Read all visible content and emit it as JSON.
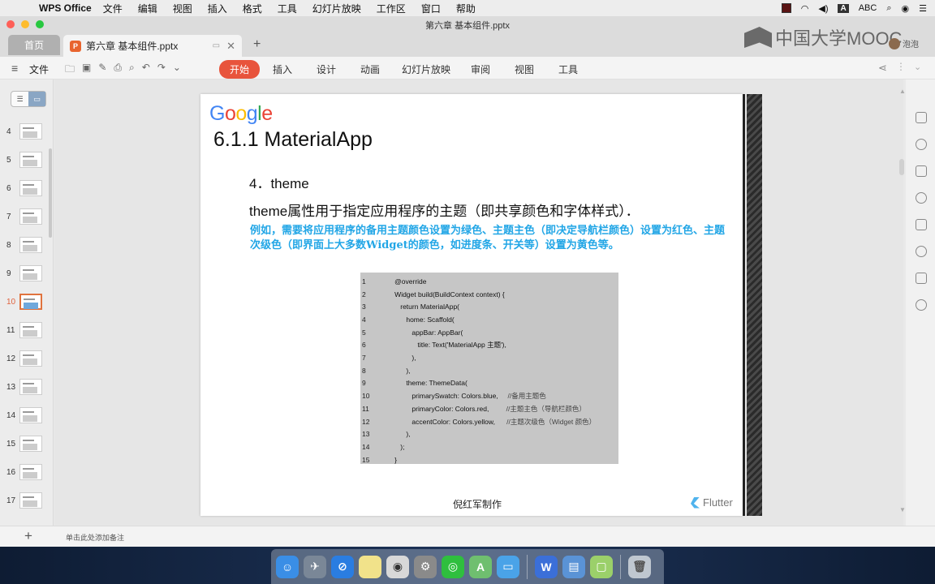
{
  "menubar": {
    "app_name": "WPS Office",
    "items": [
      "文件",
      "编辑",
      "视图",
      "插入",
      "格式",
      "工具",
      "幻灯片放映",
      "工作区",
      "窗口",
      "帮助"
    ],
    "input_label": "A",
    "input_method": "ABC"
  },
  "window": {
    "title": "第六章 基本组件.pptx"
  },
  "tabs": {
    "home_label": "首页",
    "doc_icon": "P",
    "doc_label": "第六章 基本组件.pptx",
    "add": "+"
  },
  "branding": {
    "mooc": "中国大学MOOC",
    "user": "泡泡"
  },
  "ribbon": {
    "file_label": "文件",
    "tabs": [
      "开始",
      "插入",
      "设计",
      "动画",
      "幻灯片放映",
      "审阅",
      "视图",
      "工具"
    ],
    "active_tab": "开始"
  },
  "slides_panel": {
    "thumbnails": [
      "4",
      "5",
      "6",
      "7",
      "8",
      "9",
      "10",
      "11",
      "12",
      "13",
      "14",
      "15",
      "16",
      "17"
    ],
    "current": "10"
  },
  "slide": {
    "logo": "Google",
    "title": "6.1.1 MaterialApp",
    "subtitle": "4．theme",
    "description": "theme属性用于指定应用程序的主题（即共享颜色和字体样式）．",
    "highlight": "例如，需要将应用程序的备用主题颜色设置为绿色、主题主色（即决定导航栏颜色）设置为红色、主题次级色（即界面上大多数Widget的颜色，如进度条、开关等）设置为黄色等。",
    "code": [
      {
        "n": "1",
        "text": "      @override",
        "comment": ""
      },
      {
        "n": "2",
        "text": "      Widget build(BuildContext context) {",
        "comment": ""
      },
      {
        "n": "3",
        "text": "         return MaterialApp(",
        "comment": ""
      },
      {
        "n": "4",
        "text": "            home: Scaffold(",
        "comment": ""
      },
      {
        "n": "5",
        "text": "               appBar: AppBar(",
        "comment": ""
      },
      {
        "n": "6",
        "text": "                  title: Text('MaterialApp 主题'),",
        "comment": ""
      },
      {
        "n": "7",
        "text": "               ),",
        "comment": ""
      },
      {
        "n": "8",
        "text": "            ),",
        "comment": ""
      },
      {
        "n": "9",
        "text": "            theme: ThemeData(",
        "comment": ""
      },
      {
        "n": "10",
        "text": "               primarySwatch: Colors.blue,     ",
        "comment": "//备用主题色"
      },
      {
        "n": "11",
        "text": "               primaryColor: Colors.red,         ",
        "comment": "//主题主色（导航栏颜色）"
      },
      {
        "n": "12",
        "text": "               accentColor: Colors.yellow,      ",
        "comment": "//主题次级色（Widget 颜色）"
      },
      {
        "n": "13",
        "text": "            ),",
        "comment": ""
      },
      {
        "n": "14",
        "text": "         );",
        "comment": ""
      },
      {
        "n": "15",
        "text": "      }",
        "comment": ""
      }
    ],
    "footer": "倪红军制作",
    "flutter_label": "Flutter"
  },
  "notes": {
    "add": "+",
    "placeholder": "单击此处添加备注"
  },
  "colors": {
    "accent": "#e8543c",
    "highlight_text": "#22a6e6",
    "google": [
      "#4285F4",
      "#EA4335",
      "#FBBC05",
      "#4285F4",
      "#34A853",
      "#EA4335"
    ]
  }
}
